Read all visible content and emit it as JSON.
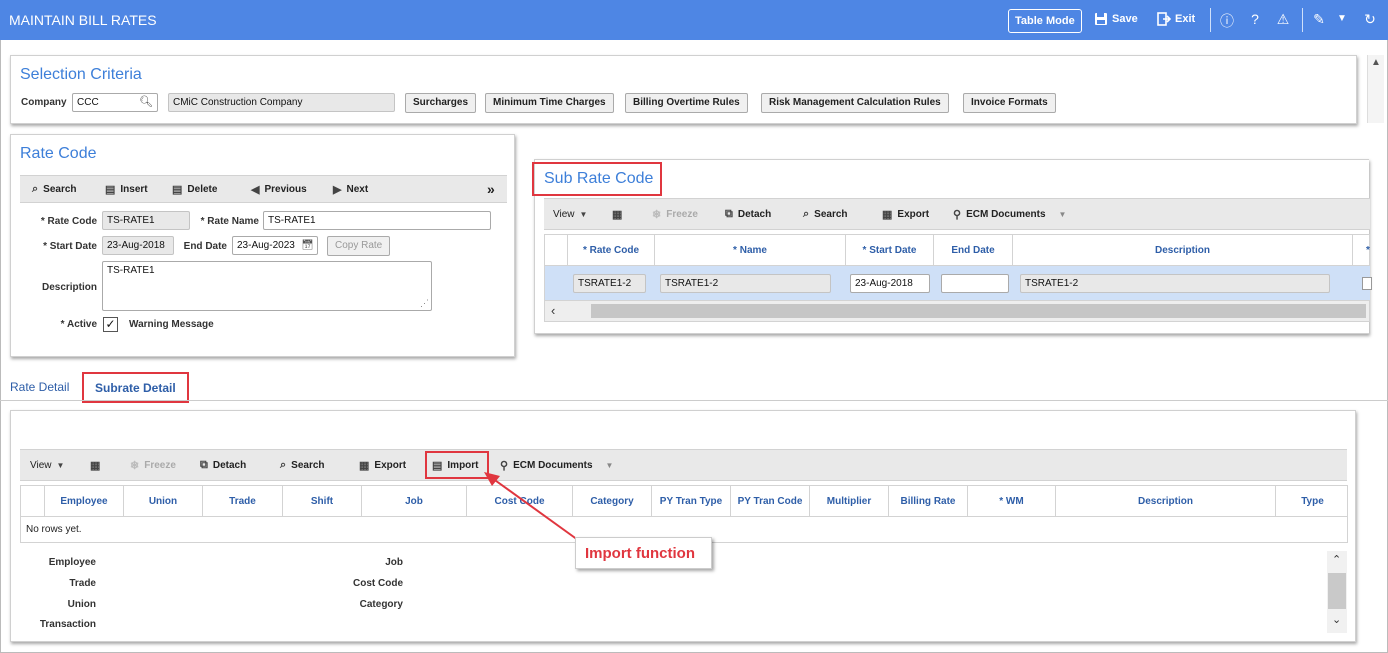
{
  "app": {
    "title": "MAINTAIN BILL RATES",
    "table_mode": "Table Mode",
    "save": "Save",
    "exit": "Exit"
  },
  "selection": {
    "title": "Selection Criteria",
    "company_label": "Company",
    "company_value": "CCC",
    "company_name": "CMiC Construction Company",
    "buttons": [
      "Surcharges",
      "Minimum Time Charges",
      "Billing Overtime Rules",
      "Risk Management Calculation Rules",
      "Invoice Formats"
    ]
  },
  "rate_code": {
    "title": "Rate Code",
    "toolbar": {
      "search": "Search",
      "insert": "Insert",
      "delete": "Delete",
      "previous": "Previous",
      "next": "Next"
    },
    "rate_code_label": "Rate Code",
    "rate_code_value": "TS-RATE1",
    "rate_name_label": "Rate Name",
    "rate_name_value": "TS-RATE1",
    "start_date_label": "Start Date",
    "start_date_value": "23-Aug-2018",
    "end_date_label": "End Date",
    "end_date_value": "23-Aug-2023",
    "copy_rate": "Copy Rate",
    "description_label": "Description",
    "description_value": "TS-RATE1",
    "active_label": "Active",
    "warning_label": "Warning Message"
  },
  "sub_rate": {
    "title": "Sub Rate Code",
    "toolbar": {
      "view": "View",
      "freeze": "Freeze",
      "detach": "Detach",
      "search": "Search",
      "export": "Export",
      "ecm": "ECM Documents"
    },
    "columns": [
      "* Rate Code",
      "* Name",
      "* Start Date",
      "End Date",
      "Description",
      "*"
    ],
    "row": {
      "rate_code": "TSRATE1-2",
      "name": "TSRATE1-2",
      "start_date": "23-Aug-2018",
      "end_date": "",
      "description": "TSRATE1-2"
    }
  },
  "tabs": [
    "Rate Detail",
    "Subrate Detail"
  ],
  "subrate_detail": {
    "toolbar": {
      "view": "View",
      "freeze": "Freeze",
      "detach": "Detach",
      "search": "Search",
      "export": "Export",
      "import": "Import",
      "ecm": "ECM Documents"
    },
    "columns": [
      "Employee",
      "Union",
      "Trade",
      "Shift",
      "Job",
      "Cost Code",
      "Category",
      "PY Tran Type",
      "PY Tran Code",
      "Multiplier",
      "Billing Rate",
      "* WM",
      "Description",
      "Type"
    ],
    "empty": "No rows yet.",
    "fields_left": [
      "Employee",
      "Trade",
      "Union",
      "Transaction"
    ],
    "fields_right": [
      "Job",
      "Cost Code",
      "Category"
    ]
  },
  "annotation": "Import function",
  "colors": {
    "header": "#4e86e4",
    "title": "#3d7fd9",
    "highlight": "#e0363f"
  }
}
